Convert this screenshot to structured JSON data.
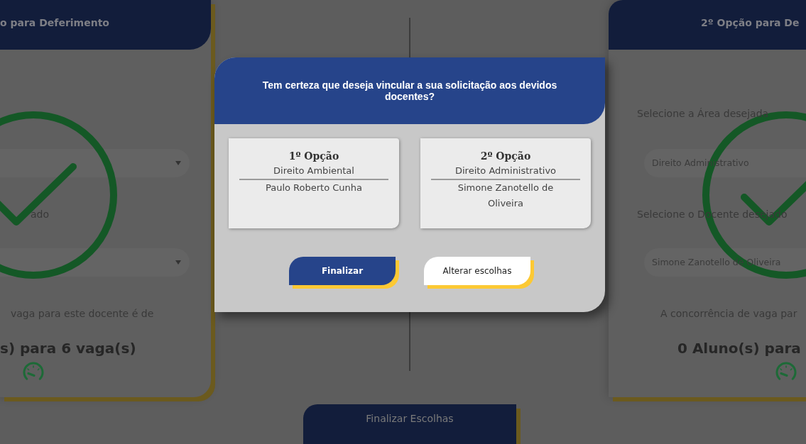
{
  "background": {
    "cards": [
      {
        "kind": "left",
        "title": "o para Deferimento",
        "docente_label": "ado",
        "concurrence_text": "vaga para este docente é de",
        "count_text": "s) para 6 vaga(s)",
        "confirmed": true
      },
      {
        "kind": "right",
        "title": "2º Opção para De",
        "area_label": "Selecione a Área desejada",
        "area_value": "Direito Administrativo",
        "docente_label": "Selecione o Docente desejado",
        "docente_value": "Simone Zanotello de Oliveira",
        "concurrence_text": "A concorrência de vaga par",
        "count_text": "0 Aluno(s) para",
        "confirmed": true
      }
    ],
    "finish_button": {
      "label": "Finalizar Escolhas"
    }
  },
  "dialog": {
    "title": "Tem certeza que deseja vincular a sua solicitação aos devidos docentes?",
    "options": [
      {
        "heading": "1º Opção",
        "area": "Direito Ambiental",
        "docente": "Paulo Roberto Cunha"
      },
      {
        "heading": "2º Opção",
        "area": "Direito Administrativo",
        "docente": "Simone Zanotello de Oliveira"
      }
    ],
    "buttons": [
      {
        "kind": "primary",
        "label": "Finalizar"
      },
      {
        "kind": "secondary",
        "label": "Alterar escolhas"
      }
    ]
  }
}
